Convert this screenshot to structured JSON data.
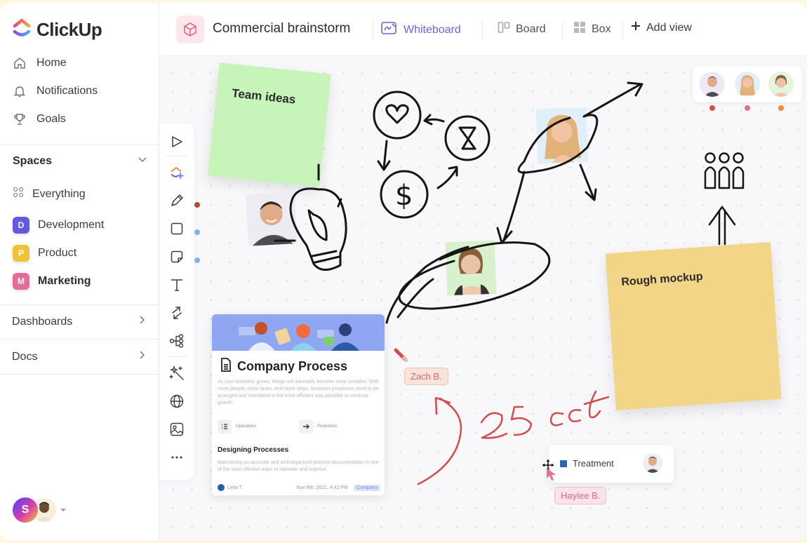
{
  "app": {
    "brand": "ClickUp",
    "colors": {
      "accent": "#6b63d9",
      "development": "#6457e0",
      "product": "#f2c13a",
      "marketing": "#e66b97",
      "sticky_green": "#c6f4b9",
      "sticky_yellow": "#f3d588",
      "ink_red": "#d24c4c"
    }
  },
  "sidebar": {
    "nav": [
      {
        "label": "Home",
        "icon": "home-icon"
      },
      {
        "label": "Notifications",
        "icon": "bell-icon"
      },
      {
        "label": "Goals",
        "icon": "trophy-icon"
      }
    ],
    "spaces_label": "Spaces",
    "everything_label": "Everything",
    "spaces": [
      {
        "badge": "D",
        "label": "Development"
      },
      {
        "badge": "P",
        "label": "Product"
      },
      {
        "badge": "M",
        "label": "Marketing"
      }
    ],
    "dashboards_label": "Dashboards",
    "docs_label": "Docs",
    "user_initial": "S"
  },
  "header": {
    "title": "Commercial brainstorm",
    "views": [
      {
        "label": "Whiteboard",
        "active": true
      },
      {
        "label": "Board",
        "active": false
      },
      {
        "label": "Box",
        "active": false
      }
    ],
    "add_view_label": "Add view"
  },
  "toolbar": {
    "tools": [
      "cursor-icon",
      "clickup-ai-icon",
      "pen-icon",
      "shape-icon",
      "sticky-note-icon",
      "text-icon",
      "connector-icon",
      "mindmap-icon",
      "magic-icon",
      "globe-icon",
      "image-icon",
      "more-icon"
    ]
  },
  "canvas": {
    "sticky_notes": [
      {
        "text": "Team ideas",
        "color": "green"
      },
      {
        "text": "Rough mockup",
        "color": "yellow"
      }
    ],
    "handwriting": "25 oct",
    "collaborator_tags": [
      "Zach B.",
      "Haylee B."
    ],
    "presence_dots": [
      "#d84a4a",
      "#e56d95",
      "#f08a3e"
    ],
    "doc_card": {
      "title": "Company Process",
      "body": "As your business grows, things will inevitably become more complex. With more people, more tasks, and more steps, business processes need to be arranged and mandated in the most efficient way possible to continue growth.",
      "links": [
        "Operations",
        "Production"
      ],
      "subtitle": "Designing Processes",
      "sub_body": "Maintaining as accurate and well-organized process documentation is one of the most efficient ways to maintain and improve.",
      "author": "Leila T.",
      "date": "Nov 8th, 2021, 4:42 PM",
      "tag": "Company"
    },
    "task_card": {
      "label": "Treatment"
    }
  }
}
